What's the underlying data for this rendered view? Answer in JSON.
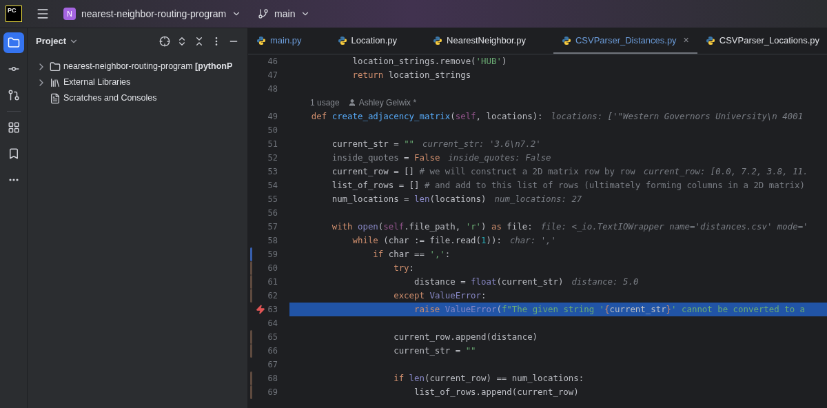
{
  "title_bar": {
    "app_logo": "PC",
    "project_initial": "N",
    "project_name": "nearest-neighbor-routing-program",
    "branch": "main"
  },
  "tool_strip": [
    {
      "kind": "project",
      "selected": true
    },
    {
      "kind": "commit",
      "selected": false
    },
    {
      "kind": "pull_requests",
      "selected": false
    },
    {
      "kind": "structure",
      "selected": false
    },
    {
      "kind": "bookmarks",
      "selected": false
    },
    {
      "kind": "more",
      "selected": false
    }
  ],
  "project_panel": {
    "title": "Project",
    "tree": [
      {
        "label": "nearest-neighbor-routing-program **[pythonP**",
        "kind": "folder",
        "expanded": false
      },
      {
        "label": "External Libraries",
        "kind": "libraries",
        "expanded": false
      },
      {
        "label": "Scratches and Consoles",
        "kind": "scratches"
      }
    ]
  },
  "tabs": [
    {
      "label": "main.py",
      "selected": false,
      "modified": true
    },
    {
      "label": "Location.py",
      "selected": false,
      "modified": false
    },
    {
      "label": "NearestNeighbor.py",
      "selected": false,
      "modified": false
    },
    {
      "label": "CSVParser_Distances.py",
      "selected": true,
      "modified": true,
      "close": "×"
    },
    {
      "label": "CSVParser_Locations.py",
      "selected": false,
      "modified": false
    }
  ],
  "editor": {
    "lines": [
      {
        "kind": "code",
        "number": "46",
        "tokens": [
          {
            "kind": "plain",
            "text": "            location_strings.remove("
          },
          {
            "kind": "str",
            "text": "'HUB'"
          },
          {
            "kind": "plain",
            "text": ")"
          }
        ]
      },
      {
        "kind": "code",
        "number": "47",
        "tokens": [
          {
            "kind": "kw",
            "text": "            return "
          },
          {
            "kind": "plain",
            "text": "location_strings"
          }
        ]
      },
      {
        "kind": "code",
        "number": "48"
      },
      {
        "kind": "usage",
        "count": "1 usage",
        "author": "Ashley Gelwix *"
      },
      {
        "kind": "code",
        "number": "49",
        "tokens": [
          {
            "kind": "kw",
            "text": "    def "
          },
          {
            "kind": "fn",
            "text": "create_adjacency_matrix"
          },
          {
            "kind": "plain",
            "text": "("
          },
          {
            "kind": "self",
            "text": "self"
          },
          {
            "kind": "plain",
            "text": ", locations):"
          }
        ],
        "hint": "locations: ['\"Western Governors University\\n 4001"
      },
      {
        "kind": "code",
        "number": "50"
      },
      {
        "kind": "code",
        "number": "51",
        "tokens": [
          {
            "kind": "plain",
            "text": "        current_str = "
          },
          {
            "kind": "str",
            "text": "\"\""
          }
        ],
        "hint": "current_str: '3.6\\n7.2'"
      },
      {
        "kind": "code",
        "number": "52",
        "tokens": [
          {
            "kind": "unused",
            "text": "        inside_quotes"
          },
          {
            "kind": "plain",
            "text": " = "
          },
          {
            "kind": "kw",
            "text": "False"
          }
        ],
        "hint": "inside_quotes: False"
      },
      {
        "kind": "code",
        "number": "53",
        "tokens": [
          {
            "kind": "plain",
            "text": "        current_row = []"
          },
          {
            "kind": "comment",
            "text": " # we will construct a 2D matrix row by row"
          }
        ],
        "hint": "current_row: [0.0, 7.2, 3.8, 11."
      },
      {
        "kind": "code",
        "number": "54",
        "tokens": [
          {
            "kind": "plain",
            "text": "        list_of_rows = []"
          },
          {
            "kind": "comment",
            "text": " # and add to this list of rows (ultimately forming columns in a 2D matrix)"
          }
        ]
      },
      {
        "kind": "code",
        "number": "55",
        "tokens": [
          {
            "kind": "plain",
            "text": "        num_locations = "
          },
          {
            "kind": "builtin",
            "text": "len"
          },
          {
            "kind": "plain",
            "text": "(locations)"
          }
        ],
        "hint": "num_locations: 27"
      },
      {
        "kind": "code",
        "number": "56"
      },
      {
        "kind": "code",
        "number": "57",
        "tokens": [
          {
            "kind": "kw",
            "text": "        with "
          },
          {
            "kind": "builtin",
            "text": "open"
          },
          {
            "kind": "plain",
            "text": "("
          },
          {
            "kind": "self",
            "text": "self"
          },
          {
            "kind": "plain",
            "text": ".file_path, "
          },
          {
            "kind": "str",
            "text": "'r'"
          },
          {
            "kind": "plain",
            "text": ") "
          },
          {
            "kind": "kw",
            "text": "as"
          },
          {
            "kind": "plain",
            "text": " file:"
          }
        ],
        "hint": "file: <_io.TextIOWrapper name='distances.csv' mode='"
      },
      {
        "kind": "code",
        "number": "58",
        "tokens": [
          {
            "kind": "kw",
            "text": "            while "
          },
          {
            "kind": "plain",
            "text": "(char := file.read("
          },
          {
            "kind": "num",
            "text": "1"
          },
          {
            "kind": "plain",
            "text": ")):"
          }
        ],
        "hint": "char: ','"
      },
      {
        "kind": "code",
        "number": "59",
        "color": "#375fad",
        "tokens": [
          {
            "kind": "kw",
            "text": "                if "
          },
          {
            "kind": "plain",
            "text": "char == "
          },
          {
            "kind": "str",
            "text": "','"
          },
          {
            "kind": "plain",
            "text": ":"
          }
        ]
      },
      {
        "kind": "code",
        "number": "60",
        "color": "#5e4a3f",
        "tokens": [
          {
            "kind": "kw",
            "text": "                    try"
          },
          {
            "kind": "plain",
            "text": ":"
          }
        ]
      },
      {
        "kind": "code",
        "number": "61",
        "color": "#5e4a3f",
        "tokens": [
          {
            "kind": "plain",
            "text": "                        distance = "
          },
          {
            "kind": "builtin",
            "text": "float"
          },
          {
            "kind": "plain",
            "text": "(current_str)"
          }
        ],
        "hint": "distance: 5.0"
      },
      {
        "kind": "code",
        "number": "62",
        "color": "#5e4a3f",
        "tokens": [
          {
            "kind": "kw",
            "text": "                    except "
          },
          {
            "kind": "builtin",
            "text": "ValueError"
          },
          {
            "kind": "plain",
            "text": ":"
          }
        ]
      },
      {
        "kind": "code",
        "number": "63",
        "exception": true,
        "highlighted": true,
        "tokens": [
          {
            "kind": "kw",
            "text": "                        raise "
          },
          {
            "kind": "builtin",
            "text": "ValueError"
          },
          {
            "kind": "plain",
            "text": "("
          },
          {
            "kind": "str",
            "text": "f\"The given string '"
          },
          {
            "kind": "kw",
            "text": "{"
          },
          {
            "kind": "plain",
            "text": "current_str"
          },
          {
            "kind": "kw",
            "text": "}"
          },
          {
            "kind": "str",
            "text": "' cannot be converted to a"
          }
        ]
      },
      {
        "kind": "code",
        "number": "64"
      },
      {
        "kind": "code",
        "number": "65",
        "color": "#5e4a3f",
        "tokens": [
          {
            "kind": "plain",
            "text": "                    current_row.append(distance)"
          }
        ]
      },
      {
        "kind": "code",
        "number": "66",
        "color": "#5e4a3f",
        "tokens": [
          {
            "kind": "plain",
            "text": "                    current_str = "
          },
          {
            "kind": "str",
            "text": "\"\""
          }
        ]
      },
      {
        "kind": "code",
        "number": "67"
      },
      {
        "kind": "code",
        "number": "68",
        "color": "#5e4a3f",
        "tokens": [
          {
            "kind": "kw",
            "text": "                    if "
          },
          {
            "kind": "builtin",
            "text": "len"
          },
          {
            "kind": "plain",
            "text": "(current_row) == num_locations:"
          }
        ]
      },
      {
        "kind": "code",
        "number": "69",
        "color": "#5e4a3f",
        "tokens": [
          {
            "kind": "plain",
            "text": "                        list_of_rows.append(current_row)"
          }
        ]
      }
    ]
  }
}
